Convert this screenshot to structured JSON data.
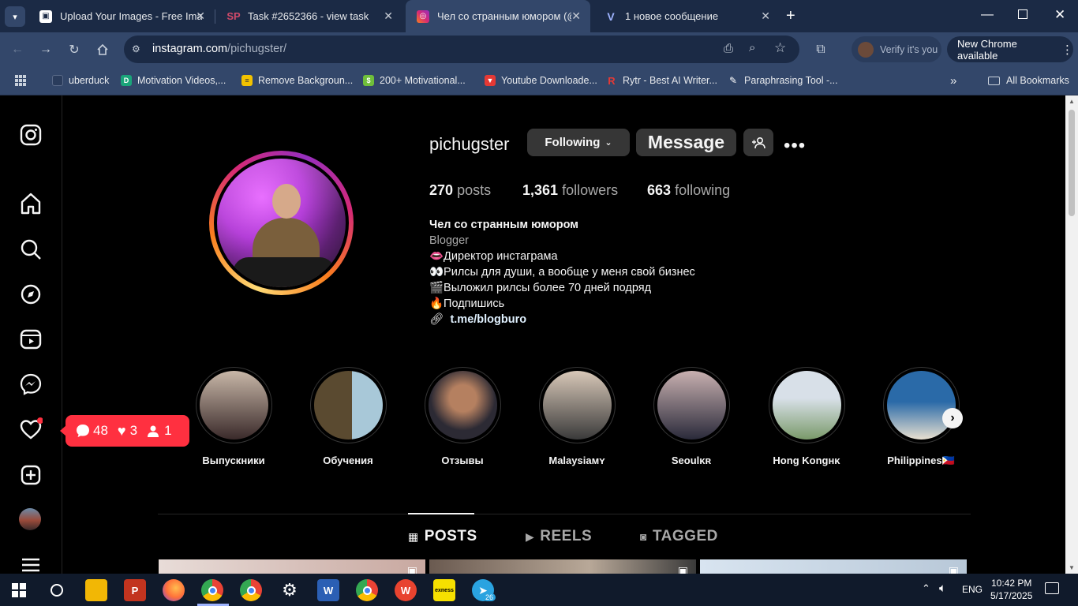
{
  "browser": {
    "tabs": [
      {
        "title": "Upload Your Images - Free Ima",
        "favicon": "image-upload-icon",
        "active": false
      },
      {
        "title": "Task #2652366 - view task",
        "favicon": "sp-icon",
        "active": false
      },
      {
        "title": "Чел со странным юмором (@p",
        "favicon": "instagram-icon",
        "active": true
      },
      {
        "title": "1 новое сообщение",
        "favicon": "v-icon",
        "active": false
      }
    ],
    "address": {
      "domain": "instagram.com",
      "path": "/pichugster/"
    },
    "verify_label": "Verify it's you",
    "new_chrome_label": "New Chrome available",
    "bookmarks": [
      {
        "label": "uberduck",
        "color": "#1b2a45"
      },
      {
        "label": "Motivation Videos,...",
        "color": "#1aa57a"
      },
      {
        "label": "Remove Backgroun...",
        "color": "#f2c200"
      },
      {
        "label": "200+ Motivational...",
        "color": "#6fbf3a"
      },
      {
        "label": "Youtube Downloade...",
        "color": "#e53935"
      },
      {
        "label": "Rytr - Best AI Writer...",
        "color": "#e53935"
      },
      {
        "label": "Paraphrasing Tool -...",
        "color": "#ffffff"
      }
    ],
    "all_bookmarks_label": "All Bookmarks"
  },
  "profile": {
    "username": "pichugster",
    "following_button": "Following",
    "message_button": "Message",
    "stats": {
      "posts_count": "270",
      "posts_label": "posts",
      "followers_count": "1,361",
      "followers_label": "followers",
      "following_count": "663",
      "following_label": "following"
    },
    "bio": {
      "name": "Чел со странным юмором",
      "category": "Blogger",
      "lines": [
        "👄Директор инстаграма",
        "👀Рилсы для души, а вообще у меня свой бизнес",
        "🎬Выложил рилсы более 70 дней подряд",
        "🔥Подпишись"
      ],
      "link": "t.me/blogburo"
    }
  },
  "notification": {
    "comments": "48",
    "likes": "3",
    "follows": "1"
  },
  "highlights": [
    {
      "label": "Выпускники",
      "colors": [
        "#3a2a2a",
        "#c8b7a8"
      ]
    },
    {
      "label": "Обучения",
      "colors": [
        "#5a4a30",
        "#a8c8d8"
      ]
    },
    {
      "label": "Отзывы",
      "colors": [
        "#2c2a34",
        "#b58060"
      ]
    },
    {
      "label": "Malaysiaᴍʏ",
      "colors": [
        "#3a3a3a",
        "#d8c8b8"
      ]
    },
    {
      "label": "Seoulᴋʀ",
      "colors": [
        "#2a2a3a",
        "#c8b0b0"
      ]
    },
    {
      "label": "Hong Kongʜᴋ",
      "colors": [
        "#7a9a6a",
        "#d8e0e8"
      ]
    },
    {
      "label": "Philippines🇵🇭",
      "colors": [
        "#2a6aa8",
        "#e8e0d0"
      ]
    }
  ],
  "content_tabs": [
    {
      "label": "POSTS",
      "glyph": "▦",
      "active": true
    },
    {
      "label": "REELS",
      "glyph": "▶",
      "active": false
    },
    {
      "label": "TAGGED",
      "glyph": "◙",
      "active": false
    }
  ],
  "taskbar": {
    "time": "10:42 PM",
    "date": "5/17/2025",
    "language": "ENG",
    "telegram_badge": "26"
  }
}
